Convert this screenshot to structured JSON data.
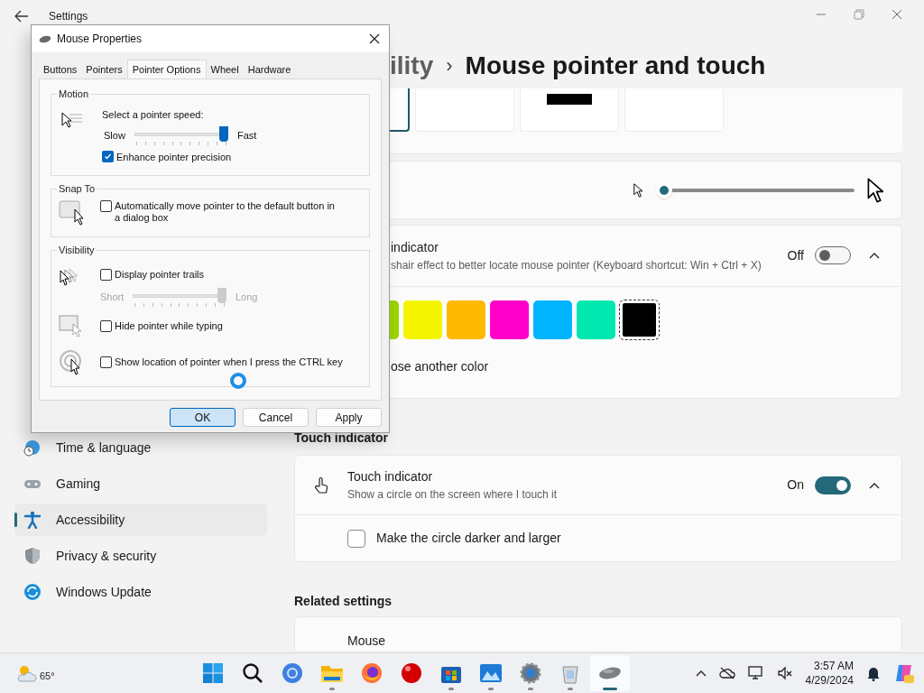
{
  "settings": {
    "title": "Settings",
    "breadcrumb_parent": "ility",
    "breadcrumb_separator": "›",
    "page_title": "Mouse pointer and touch",
    "sidebar": [
      {
        "label": "Time & language",
        "kind": "globe",
        "selected": false
      },
      {
        "label": "Gaming",
        "kind": "gamepad",
        "selected": false
      },
      {
        "label": "Accessibility",
        "kind": "person",
        "selected": true
      },
      {
        "label": "Privacy & security",
        "kind": "shield",
        "selected": false
      },
      {
        "label": "Windows Update",
        "kind": "update",
        "selected": false
      }
    ],
    "pointer_styles": [
      {
        "kind": "blank",
        "selected": true
      },
      {
        "kind": "blank",
        "selected": false
      },
      {
        "kind": "bar",
        "selected": false
      },
      {
        "kind": "blank",
        "selected": false
      }
    ],
    "size_slider": {
      "level": 0
    },
    "indicator": {
      "title": "indicator",
      "description": "shair effect to better locate mouse pointer (Keyboard shortcut: Win + Ctrl + X)",
      "state_label": "Off",
      "on": false,
      "expanded": true,
      "colors": [
        {
          "color": "#9cd400",
          "selected": false
        },
        {
          "color": "#f5f500",
          "selected": false
        },
        {
          "color": "#ffb900",
          "selected": false
        },
        {
          "color": "#ff00c8",
          "selected": false
        },
        {
          "color": "#00b4ff",
          "selected": false
        },
        {
          "color": "#00e8b0",
          "selected": false
        },
        {
          "color": "#000000",
          "selected": true
        }
      ],
      "link": "ose another color"
    },
    "touch": {
      "heading": "Touch indicator",
      "title": "Touch indicator",
      "description": "Show a circle on the screen where I touch it",
      "state_label": "On",
      "on": true,
      "expanded": true,
      "option": {
        "label": "Make the circle darker and larger",
        "checked": false
      }
    },
    "related": {
      "heading": "Related settings",
      "items": [
        "Mouse"
      ]
    }
  },
  "dialog": {
    "title": "Mouse Properties",
    "tabs": [
      {
        "label": "Buttons",
        "selected": false
      },
      {
        "label": "Pointers",
        "selected": false
      },
      {
        "label": "Pointer Options",
        "selected": true
      },
      {
        "label": "Wheel",
        "selected": false
      },
      {
        "label": "Hardware",
        "selected": false
      }
    ],
    "motion": {
      "legend": "Motion",
      "prompt": "Select a pointer speed:",
      "min_label": "Slow",
      "max_label": "Fast",
      "level": 1,
      "enhance": {
        "label": "Enhance pointer precision",
        "checked": true
      }
    },
    "snap": {
      "legend": "Snap To",
      "option": {
        "label": "Automatically move pointer to the default button in a dialog box",
        "checked": false
      }
    },
    "visibility": {
      "legend": "Visibility",
      "trails": {
        "label": "Display pointer trails",
        "checked": false
      },
      "trail_slider": {
        "min_label": "Short",
        "max_label": "Long",
        "level": 1,
        "disabled": true
      },
      "hide": {
        "label": "Hide pointer while typing",
        "checked": false
      },
      "locate": {
        "label": "Show location of pointer when I press the CTRL key",
        "checked": false
      }
    },
    "buttons": [
      {
        "label": "OK",
        "default": true
      },
      {
        "label": "Cancel",
        "default": false
      },
      {
        "label": "Apply",
        "default": false
      }
    ]
  },
  "taskbar": {
    "weather": "65°",
    "apps": [
      {
        "kind": "start",
        "running": false,
        "active": false
      },
      {
        "kind": "search",
        "running": false,
        "active": false
      },
      {
        "kind": "browser",
        "running": false,
        "active": false
      },
      {
        "kind": "folder",
        "running": true,
        "active": false
      },
      {
        "kind": "fox",
        "running": false,
        "active": false
      },
      {
        "kind": "ball",
        "running": false,
        "active": false
      },
      {
        "kind": "store",
        "running": true,
        "active": false
      },
      {
        "kind": "photo",
        "running": true,
        "active": false
      },
      {
        "kind": "gear",
        "running": true,
        "active": false
      },
      {
        "kind": "bin",
        "running": true,
        "active": false
      },
      {
        "kind": "mouse",
        "running": true,
        "active": true
      }
    ],
    "time": "3:57 AM",
    "date": "4/29/2024"
  }
}
